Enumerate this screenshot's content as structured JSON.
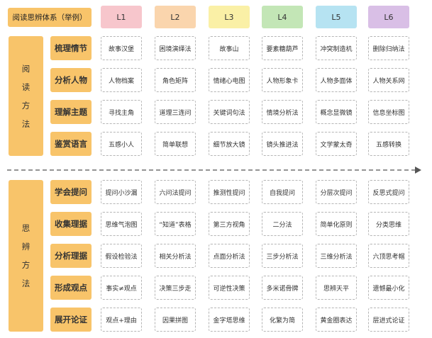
{
  "title": "阅读思辨体系（举例）",
  "levels": [
    {
      "label": "L1",
      "color": "#f7c6cc"
    },
    {
      "label": "L2",
      "color": "#fad5ad"
    },
    {
      "label": "L3",
      "color": "#faf0a6"
    },
    {
      "label": "L4",
      "color": "#c3e6b6"
    },
    {
      "label": "L5",
      "color": "#b6e3f2"
    },
    {
      "label": "L6",
      "color": "#d9bfe6"
    }
  ],
  "sections": [
    {
      "label": [
        "阅",
        "读",
        "方",
        "法"
      ],
      "rows": [
        {
          "name": "梳理情节",
          "cells": [
            "故事汉堡",
            "困境演绎法",
            "故事山",
            "要素糖葫芦",
            "冲突制造机",
            "删除归纳法"
          ]
        },
        {
          "name": "分析人物",
          "cells": [
            "人物档案",
            "角色矩阵",
            "情绪心电图",
            "人物形象卡",
            "人物多面体",
            "人物关系网"
          ]
        },
        {
          "name": "理解主题",
          "cells": [
            "寻找主角",
            "道理三连问",
            "关键词句法",
            "情境分析法",
            "概念显微镜",
            "信息坐标图"
          ]
        },
        {
          "name": "鉴赏语言",
          "cells": [
            "五感小人",
            "简单联想",
            "细节放大镜",
            "镜头推进法",
            "文学蒙太奇",
            "五感转换"
          ]
        }
      ]
    },
    {
      "label": [
        "思",
        "辨",
        "方",
        "法"
      ],
      "rows": [
        {
          "name": "学会提问",
          "cells": [
            "提问小沙漏",
            "六问法提问",
            "推测性提问",
            "自我提问",
            "分层次提问",
            "反思式提问"
          ]
        },
        {
          "name": "收集理据",
          "cells": [
            "思维气泡图",
            "“知道”表格",
            "第三方视角",
            "二分法",
            "简单化原则",
            "分类思维"
          ]
        },
        {
          "name": "分析理据",
          "cells": [
            "假设检验法",
            "相关分析法",
            "点面分析法",
            "三步分析法",
            "三维分析法",
            "六顶思考帽"
          ]
        },
        {
          "name": "形成观点",
          "cells": [
            "事实≠观点",
            "决策三步走",
            "可逆性决策",
            "多米诺骨牌",
            "思辨天平",
            "遗憾最小化"
          ]
        },
        {
          "name": "展开论证",
          "cells": [
            "观点+理由",
            "因果拼图",
            "金字塔思维",
            "化繁为简",
            "黄金圈表达",
            "层进式论证"
          ]
        }
      ]
    }
  ]
}
